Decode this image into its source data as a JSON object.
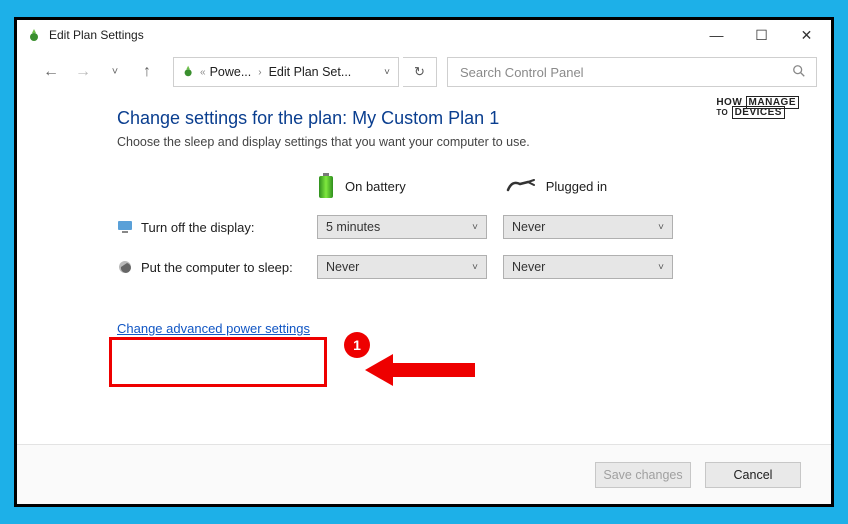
{
  "window": {
    "title": "Edit Plan Settings",
    "controls": {
      "minimize": "—",
      "maximize": "☐",
      "close": "✕"
    }
  },
  "nav": {
    "back": "←",
    "forward": "→",
    "recent_chev": "˅",
    "up": "↑",
    "breadcrumbs": [
      "Powe...",
      "Edit Plan Set..."
    ],
    "refresh": "↻"
  },
  "search": {
    "placeholder": "Search Control Panel"
  },
  "page": {
    "title": "Change settings for the plan: My Custom Plan 1",
    "subtitle": "Choose the sleep and display settings that you want your computer to use."
  },
  "columns": {
    "battery": "On battery",
    "plugged": "Plugged in"
  },
  "rows": {
    "display": {
      "label": "Turn off the display:",
      "battery_value": "5 minutes",
      "plugged_value": "Never"
    },
    "sleep": {
      "label": "Put the computer to sleep:",
      "battery_value": "Never",
      "plugged_value": "Never"
    }
  },
  "link": {
    "advanced": "Change advanced power settings"
  },
  "footer": {
    "save": "Save changes",
    "cancel": "Cancel"
  },
  "watermark": {
    "l1": "HOW",
    "l2": "MANAGE",
    "l3": "TO",
    "l4": "DEVICES"
  },
  "annotation": {
    "badge": "1"
  }
}
